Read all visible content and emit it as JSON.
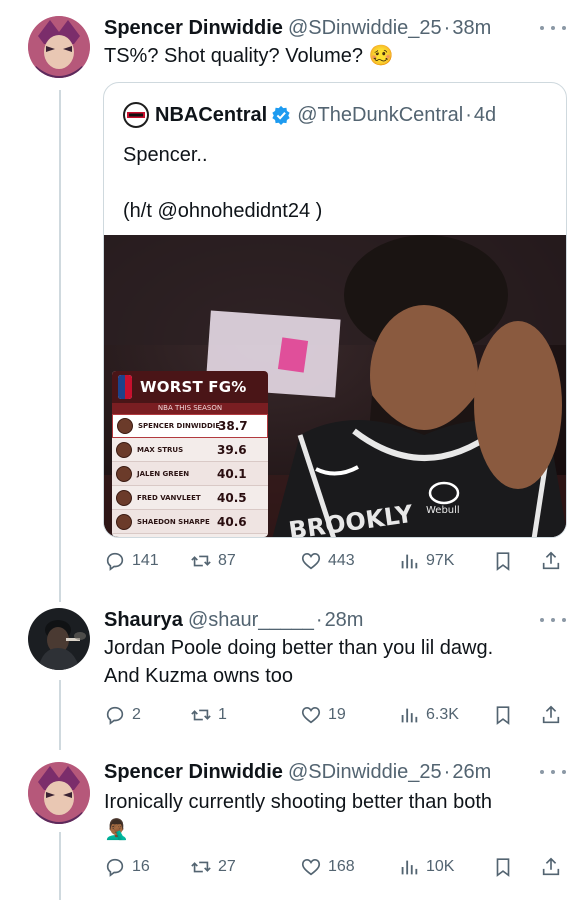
{
  "tweets": [
    {
      "name": "Spencer Dinwiddie",
      "handle": "@SDinwiddie_25",
      "time": "38m",
      "text": "TS%? Shot quality? Volume? 🥴",
      "quote": {
        "name": "NBACentral",
        "handle": "@TheDunkCentral",
        "time": "4d",
        "text": "Spencer..\n\n(h/t @ohnohedidnt24 )",
        "media": {
          "card_title": "WORST FG%",
          "card_subtitle": "NBA THIS SEASON",
          "jersey_text": "BROOKLY",
          "sponsor": "Webull",
          "rows": [
            {
              "player": "SPENCER DINWIDDIE",
              "value": "38.7"
            },
            {
              "player": "MAX STRUS",
              "value": "39.6"
            },
            {
              "player": "JALEN GREEN",
              "value": "40.1"
            },
            {
              "player": "FRED VANVLEET",
              "value": "40.5"
            },
            {
              "player": "SHAEDON SHARPE",
              "value": "40.6"
            }
          ]
        }
      },
      "stats": {
        "replies": "141",
        "reposts": "87",
        "likes": "443",
        "views": "97K"
      }
    },
    {
      "name": "Shaurya",
      "handle": "@shaur_____",
      "time": "28m",
      "text": "Jordan Poole doing better than you lil dawg.\nAnd Kuzma owns too",
      "stats": {
        "replies": "2",
        "reposts": "1",
        "likes": "19",
        "views": "6.3K"
      }
    },
    {
      "name": "Spencer Dinwiddie",
      "handle": "@SDinwiddie_25",
      "time": "26m",
      "text": "Ironically currently shooting better than both\n🤦🏾‍♂️",
      "stats": {
        "replies": "16",
        "reposts": "27",
        "likes": "168",
        "views": "10K"
      }
    }
  ],
  "separator": "·",
  "colors": {
    "secondary_text": "#536471",
    "thread_line": "#cfd9de",
    "verified": "#1d9bf0"
  },
  "icons": [
    "more-icon",
    "verified-icon",
    "reply-icon",
    "repost-icon",
    "like-icon",
    "views-icon",
    "bookmark-icon",
    "share-icon"
  ]
}
